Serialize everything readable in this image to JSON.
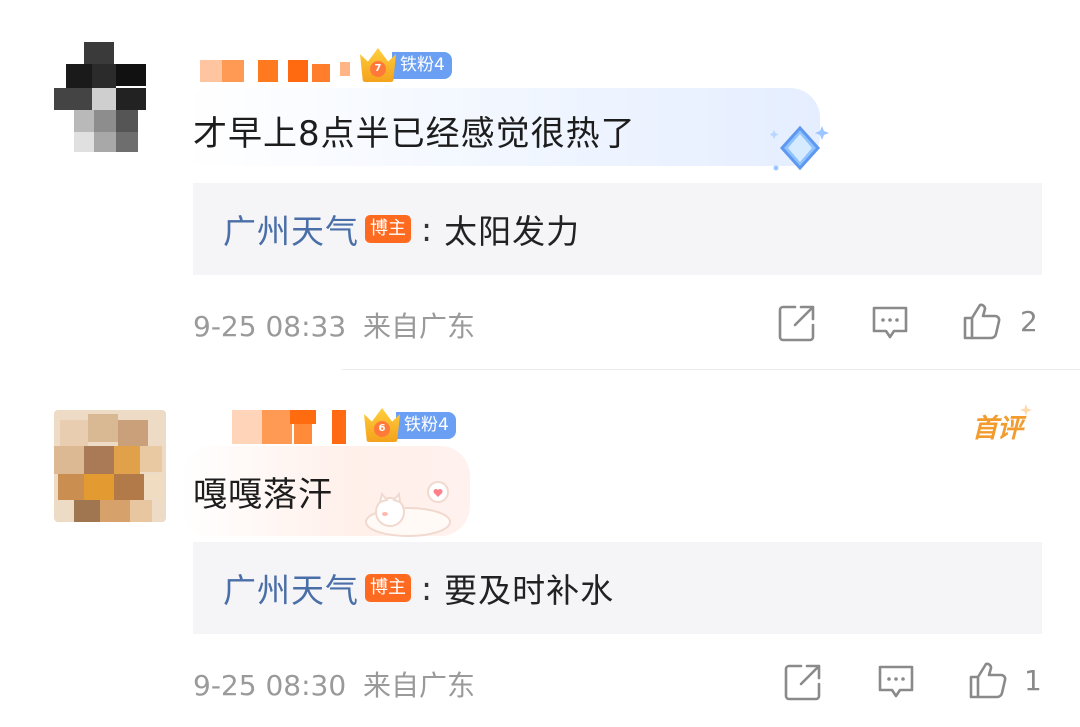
{
  "comments": [
    {
      "fan_badge": "铁粉4",
      "fan_level": "7",
      "text": "才早上8点半已经感觉很热了",
      "reply": {
        "author": "广州天气",
        "tag": "博主",
        "separator": ":",
        "text": "太阳发力"
      },
      "time": "9-25 08:33",
      "location": "来自广东",
      "likes": "2"
    },
    {
      "fan_badge": "铁粉4",
      "fan_level": "6",
      "text": "嘎嘎落汗",
      "first_badge": "首评",
      "reply": {
        "author": "广州天气",
        "tag": "博主",
        "separator": ":",
        "text": "要及时补水"
      },
      "time": "9-25 08:30",
      "location": "来自广东",
      "likes": "1"
    }
  ],
  "icons": [
    "share-icon",
    "comment-icon",
    "like-icon",
    "crown-icon",
    "diamond-sticker-icon",
    "cat-sticker-icon"
  ],
  "colors": {
    "accent_link": "#4a6fa8",
    "blogger_tag": "#ff6a21",
    "fan_badge": "#6b9ff3",
    "first_badge": "#f29b2e"
  }
}
